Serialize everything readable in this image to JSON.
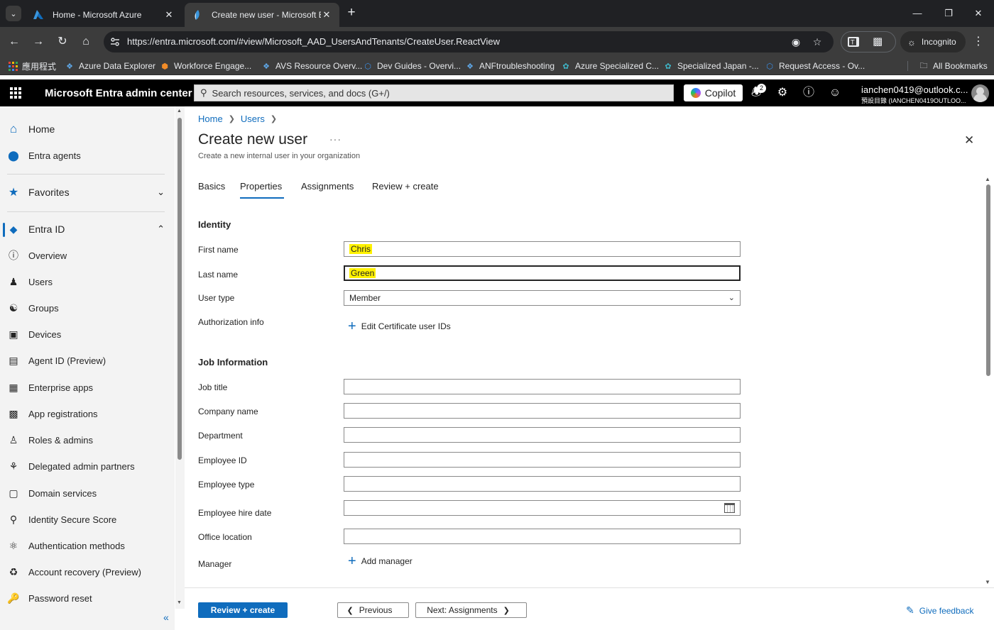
{
  "browser": {
    "tabs": [
      {
        "title": "Home - Microsoft Azure",
        "active": false
      },
      {
        "title": "Create new user - Microsoft Entra",
        "active": true
      }
    ],
    "url": "https://entra.microsoft.com/#view/Microsoft_AAD_UsersAndTenants/CreateUser.ReactView",
    "incognito_label": "Incognito",
    "bookmarks": [
      {
        "label": "應用程式",
        "icon": "apps-grid-icon"
      },
      {
        "label": "Azure Data Explorer",
        "icon": "data-explorer-icon"
      },
      {
        "label": "Workforce Engage...",
        "icon": "workforce-icon"
      },
      {
        "label": "AVS Resource Overv...",
        "icon": "avs-icon"
      },
      {
        "label": "Dev Guides - Overvi...",
        "icon": "devguides-icon"
      },
      {
        "label": "ANFtroubleshooting",
        "icon": "anf-icon"
      },
      {
        "label": "Azure Specialized C...",
        "icon": "specialized-icon"
      },
      {
        "label": "Specialized Japan -...",
        "icon": "specialized-japan-icon"
      },
      {
        "label": "Request Access - Ov...",
        "icon": "request-access-icon"
      }
    ],
    "all_bookmarks_label": "All Bookmarks"
  },
  "portal": {
    "title": "Microsoft Entra admin center",
    "search_placeholder": "Search resources, services, and docs (G+/)",
    "copilot_label": "Copilot",
    "notification_count": "2",
    "account_name": "ianchen0419@outlook.c...",
    "account_directory": "預設目錄 (IANCHEN0419OUTLOO..."
  },
  "leftnav": {
    "home": "Home",
    "entra_agents": "Entra agents",
    "favorites": "Favorites",
    "entra_id": "Entra ID",
    "items": [
      {
        "label": "Overview",
        "icon": "info-icon"
      },
      {
        "label": "Users",
        "icon": "user-icon"
      },
      {
        "label": "Groups",
        "icon": "groups-icon"
      },
      {
        "label": "Devices",
        "icon": "devices-icon"
      },
      {
        "label": "Agent ID (Preview)",
        "icon": "agent-id-icon"
      },
      {
        "label": "Enterprise apps",
        "icon": "enterprise-apps-icon"
      },
      {
        "label": "App registrations",
        "icon": "app-registrations-icon"
      },
      {
        "label": "Roles & admins",
        "icon": "roles-icon"
      },
      {
        "label": "Delegated admin partners",
        "icon": "delegated-admin-icon"
      },
      {
        "label": "Domain services",
        "icon": "domain-services-icon"
      },
      {
        "label": "Identity Secure Score",
        "icon": "secure-score-icon"
      },
      {
        "label": "Authentication methods",
        "icon": "authentication-icon"
      },
      {
        "label": "Account recovery (Preview)",
        "icon": "account-recovery-icon"
      },
      {
        "label": "Password reset",
        "icon": "password-reset-icon"
      }
    ]
  },
  "main": {
    "breadcrumb": [
      "Home",
      "Users"
    ],
    "title": "Create new user",
    "subtitle": "Create a new internal user in your organization",
    "tabs": [
      "Basics",
      "Properties",
      "Assignments",
      "Review + create"
    ],
    "active_tab": "Properties",
    "identity": {
      "section": "Identity",
      "first_name_label": "First name",
      "first_name_value": "Chris",
      "last_name_label": "Last name",
      "last_name_value": "Green",
      "user_type_label": "User type",
      "user_type_value": "Member",
      "auth_info_label": "Authorization info",
      "edit_cert_label": "Edit Certificate user IDs"
    },
    "job": {
      "section": "Job Information",
      "job_title_label": "Job title",
      "company_name_label": "Company name",
      "department_label": "Department",
      "employee_id_label": "Employee ID",
      "employee_type_label": "Employee type",
      "hire_date_label": "Employee hire date",
      "office_location_label": "Office location",
      "manager_label": "Manager",
      "add_manager_label": "Add manager"
    }
  },
  "footer": {
    "review_create": "Review + create",
    "previous": "Previous",
    "next": "Next: Assignments",
    "feedback": "Give feedback"
  }
}
